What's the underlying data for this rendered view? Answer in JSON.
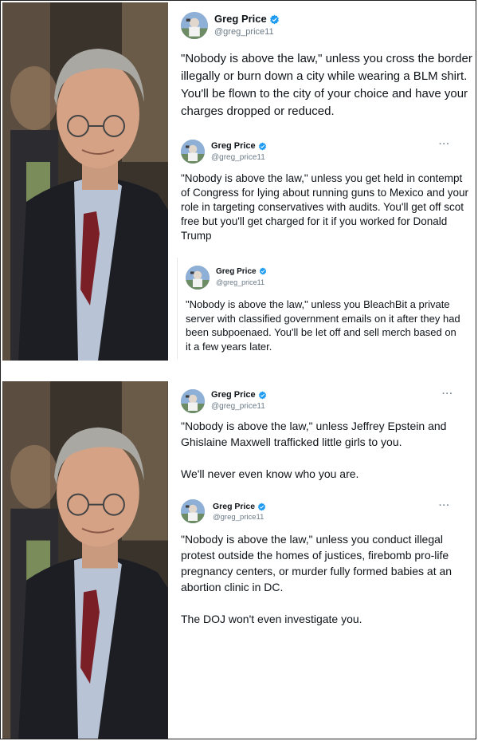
{
  "author": {
    "name": "Greg Price",
    "handle": "@greg_price11",
    "verified_color": "#1d9bf0"
  },
  "more_icon": "···",
  "tweets": [
    {
      "text": "\"Nobody is above the law,\" unless you cross the border illegally or burn down a city while wearing a BLM shirt. You'll be flown to the city of your choice and have your charges dropped or reduced."
    },
    {
      "text": "\"Nobody is above the law,\" unless you get held in contempt of Congress for lying about running guns to Mexico and your role in targeting conservatives with audits. You'll get off scot free but you'll get charged for it if you worked for Donald Trump"
    },
    {
      "text": "\"Nobody is above the law,\" unless you BleachBit a private server with classified government emails on it after they had been subpoenaed. You'll be let off and sell merch based on it a few years later."
    },
    {
      "text": "\"Nobody is above the law,\" unless Jeffrey Epstein and Ghislaine Maxwell trafficked little girls to you.\n\nWe'll never even know who you are."
    },
    {
      "text": "\"Nobody is above the law,\" unless you conduct illegal protest outside the homes of justices, firebomb pro-life pregnancy centers, or murder fully formed babies at an abortion clinic in DC.\n\nThe DOJ won't even investigate you."
    }
  ]
}
